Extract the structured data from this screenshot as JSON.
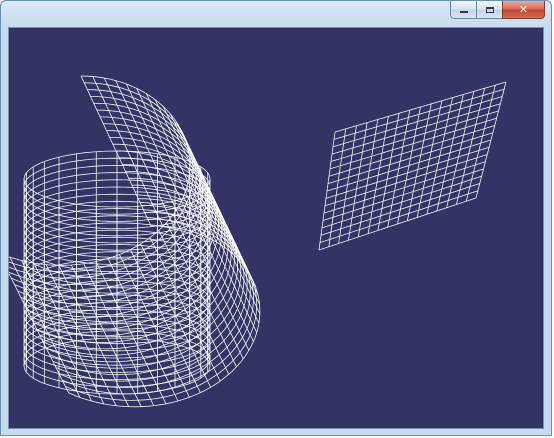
{
  "window": {
    "title": "",
    "buttons": {
      "minimize_icon": "minimize-icon",
      "maximize_icon": "maximize-icon",
      "close_icon": "close-icon",
      "close_glyph": "✕"
    }
  },
  "viewport": {
    "background_color": "#333366",
    "wire_color": "#ffffff",
    "objects": [
      {
        "name": "wireframe-cylinder",
        "kind": "cylinder"
      },
      {
        "name": "wireframe-curved-sheet",
        "kind": "curved-surface"
      },
      {
        "name": "wireframe-plane",
        "kind": "planar-grid"
      }
    ]
  },
  "colors": {
    "titlebar": "#c6dcf0",
    "close_button": "#c0442f"
  }
}
